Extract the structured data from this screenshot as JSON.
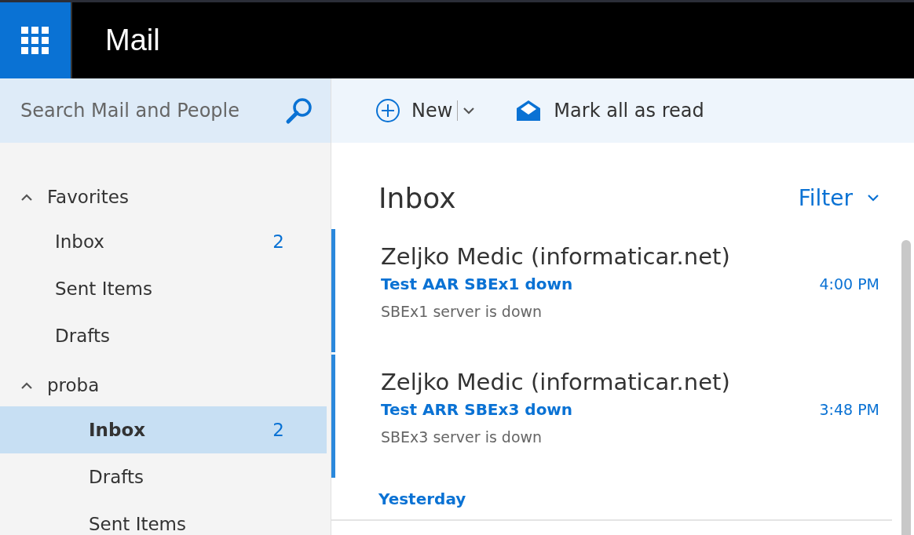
{
  "header": {
    "title": "Mail"
  },
  "search": {
    "placeholder": "Search Mail and People"
  },
  "toolbar": {
    "new_label": "New",
    "mark_read_label": "Mark all as read"
  },
  "folders": [
    {
      "label": "Favorites",
      "expanded": true,
      "children": [
        {
          "label": "Inbox",
          "count": "2",
          "selected": false
        },
        {
          "label": "Sent Items",
          "selected": false
        },
        {
          "label": "Drafts",
          "selected": false
        }
      ]
    },
    {
      "label": "proba",
      "expanded": true,
      "children": [
        {
          "label": "Inbox",
          "count": "2",
          "selected": true
        },
        {
          "label": "Drafts",
          "selected": false
        },
        {
          "label": "Sent Items",
          "selected": false
        }
      ]
    }
  ],
  "list": {
    "title": "Inbox",
    "filter": "Filter",
    "messages": [
      {
        "sender": "Zeljko Medic (informaticar.net)",
        "subject": "Test AAR SBEx1 down",
        "time": "4:00 PM",
        "preview": "SBEx1 server is down",
        "unread": true
      },
      {
        "sender": "Zeljko Medic (informaticar.net)",
        "subject": "Test ARR SBEx3 down",
        "time": "3:48 PM",
        "preview": "SBEx3 server is down",
        "unread": true
      }
    ],
    "group_label": "Yesterday"
  }
}
